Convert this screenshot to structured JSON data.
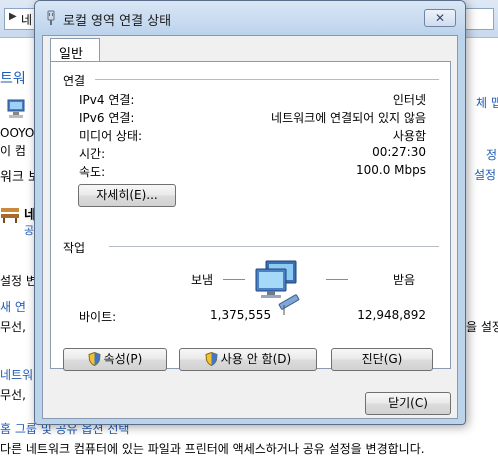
{
  "background": {
    "address_text": "네",
    "left_fragments": [
      "트워",
      "OOYO",
      "이 컴",
      "워크 보",
      "네",
      "설정 변",
      "새 연",
      "무선,",
      "네트워",
      "무선,"
    ],
    "right_fragments": [
      "체 맵",
      "정",
      "설정",
      "을 설정"
    ],
    "bottom_link": "홈 그룹 및 공유 옵션 선택",
    "bottom_text": "다른 네트워크 컴퓨터에 있는 파일과 프린터에 액세스하거나 공유 설정을 변경합니다."
  },
  "dialog": {
    "title": "로컬 영역 연결 상태",
    "close_symbol": "✕",
    "tab_general": "일반",
    "connection_section": "연결",
    "rows": [
      {
        "label": "IPv4 연결:",
        "value": "인터넷"
      },
      {
        "label": "IPv6 연결:",
        "value": "네트워크에 연결되어 있지 않음"
      },
      {
        "label": "미디어 상태:",
        "value": "사용함"
      },
      {
        "label": "시간:",
        "value": "00:27:30"
      },
      {
        "label": "속도:",
        "value": "100.0 Mbps"
      }
    ],
    "details_button": "자세히(E)...",
    "activity_section": "작업",
    "sent_label": "보냄",
    "received_label": "받음",
    "bytes_label": "바이트:",
    "bytes_sent": "1,375,555",
    "bytes_received": "12,948,892",
    "properties_button": "속성(P)",
    "disable_button": "사용 안 함(D)",
    "diagnose_button": "진단(G)",
    "close_button": "닫기(C)"
  },
  "colors": {
    "link": "#1e5bb8",
    "dialog_frame": "#bcd3ec",
    "panel": "#ffffff"
  }
}
